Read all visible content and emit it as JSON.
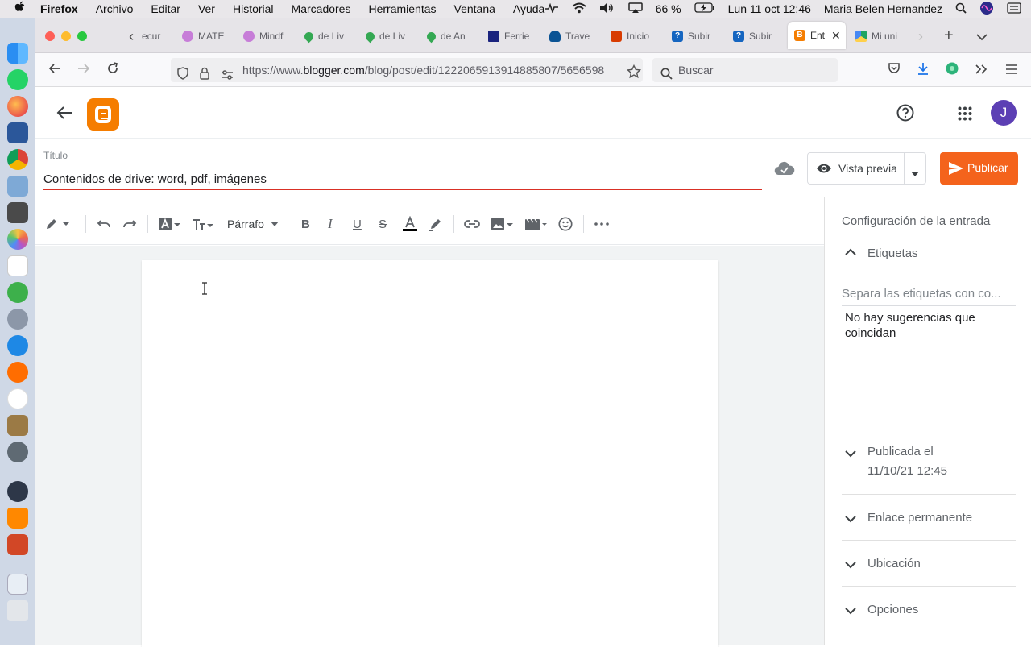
{
  "menubar": {
    "apple": "",
    "app_name": "Firefox",
    "items": [
      "Archivo",
      "Editar",
      "Ver",
      "Historial",
      "Marcadores",
      "Herramientas",
      "Ventana",
      "Ayuda"
    ],
    "battery": "66 %",
    "datetime": "Lun 11 oct  12:46",
    "user": "Maria Belen Hernandez"
  },
  "browser": {
    "tabs": [
      {
        "label": "ecur",
        "icon": "document-icon",
        "color": "#9aa0a6"
      },
      {
        "label": "MATE",
        "icon": "circle-icon",
        "color": "#c77dd8"
      },
      {
        "label": "Mindf",
        "icon": "circle-icon",
        "color": "#c77dd8"
      },
      {
        "label": "de Liv",
        "icon": "map-pin-icon",
        "color": "#34a853"
      },
      {
        "label": "de Liv",
        "icon": "map-pin-icon",
        "color": "#34a853"
      },
      {
        "label": "de An",
        "icon": "map-pin-icon",
        "color": "#34a853"
      },
      {
        "label": "Ferrie",
        "icon": "flag-icon",
        "color": "#1a237e"
      },
      {
        "label": "Trave",
        "icon": "ship-icon",
        "color": "#0b5394"
      },
      {
        "label": "Inicio",
        "icon": "office-icon",
        "color": "#d83b01"
      },
      {
        "label": "Subir",
        "icon": "help-icon",
        "color": "#1565c0"
      },
      {
        "label": "Subir",
        "icon": "help-icon",
        "color": "#1565c0"
      },
      {
        "label": "Ent",
        "icon": "blogger-icon",
        "color": "#f57d00"
      },
      {
        "label": "Mi uni",
        "icon": "drive-icon",
        "color": "#1fa463"
      }
    ],
    "url_prefix": "https://www.",
    "url_domain": "blogger.com",
    "url_path": "/blog/post/edit/1222065913914885807/5656598",
    "search_placeholder": "Buscar"
  },
  "editor": {
    "title_label": "Título",
    "title_value": "Contenidos de drive: word, pdf, imágenes",
    "preview_label": "Vista previa",
    "publish_label": "Publicar",
    "paragraph_style": "Párrafo",
    "avatar_letter": "J"
  },
  "sidebar": {
    "title": "Configuración de la entrada",
    "labels_section": "Etiquetas",
    "labels_placeholder": "Separa las etiquetas con co...",
    "no_suggestions": "No hay sugerencias que coincidan",
    "published_label": "Publicada el",
    "published_date": "11/10/21 12:45",
    "permalink": "Enlace permanente",
    "location": "Ubicación",
    "options": "Opciones"
  },
  "colors": {
    "accent": "#f4631c",
    "blogger": "#f57d00",
    "avatar": "#5c3fb4",
    "title_underline": "#d93025"
  }
}
